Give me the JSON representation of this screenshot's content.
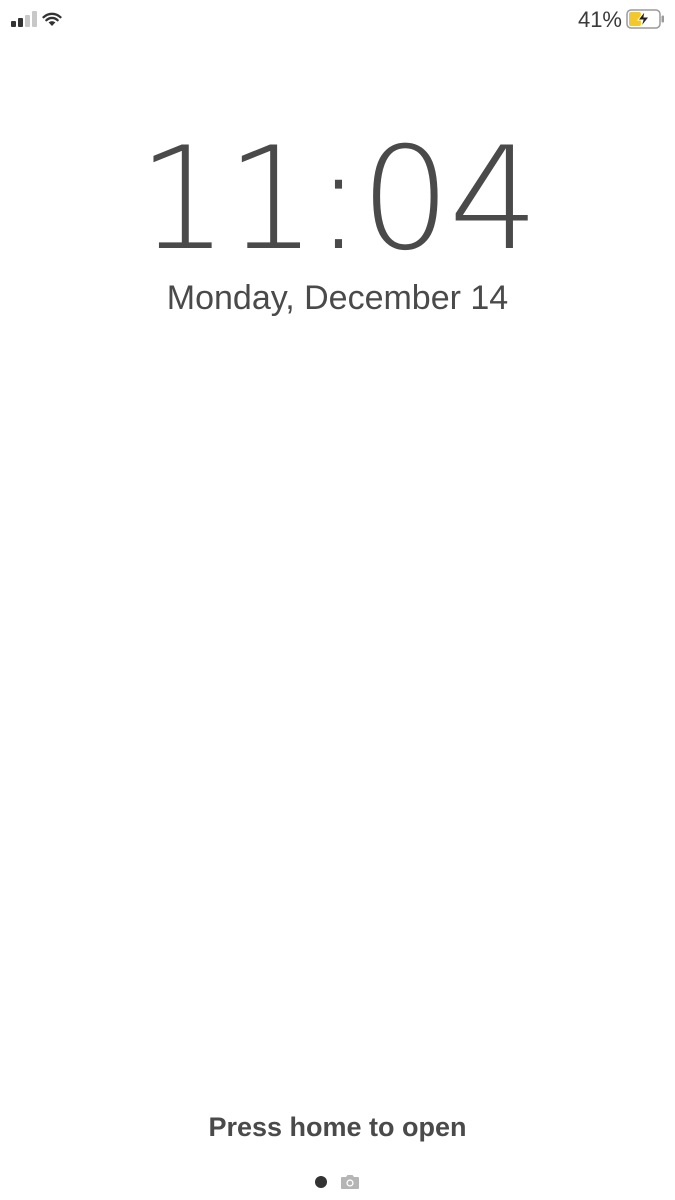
{
  "status_bar": {
    "signal_icon": "cellular-signal-icon",
    "wifi_icon": "wifi-icon",
    "battery_percent": "41%",
    "battery_icon": "battery-charging-icon",
    "battery_level": 0.41,
    "battery_color": "#f2c82c"
  },
  "lock_screen": {
    "time": "11:04",
    "date": "Monday, December 14",
    "unlock_hint": "Press home to open"
  },
  "page_indicator": {
    "current_icon": "page-dot-icon",
    "camera_icon": "camera-icon"
  }
}
